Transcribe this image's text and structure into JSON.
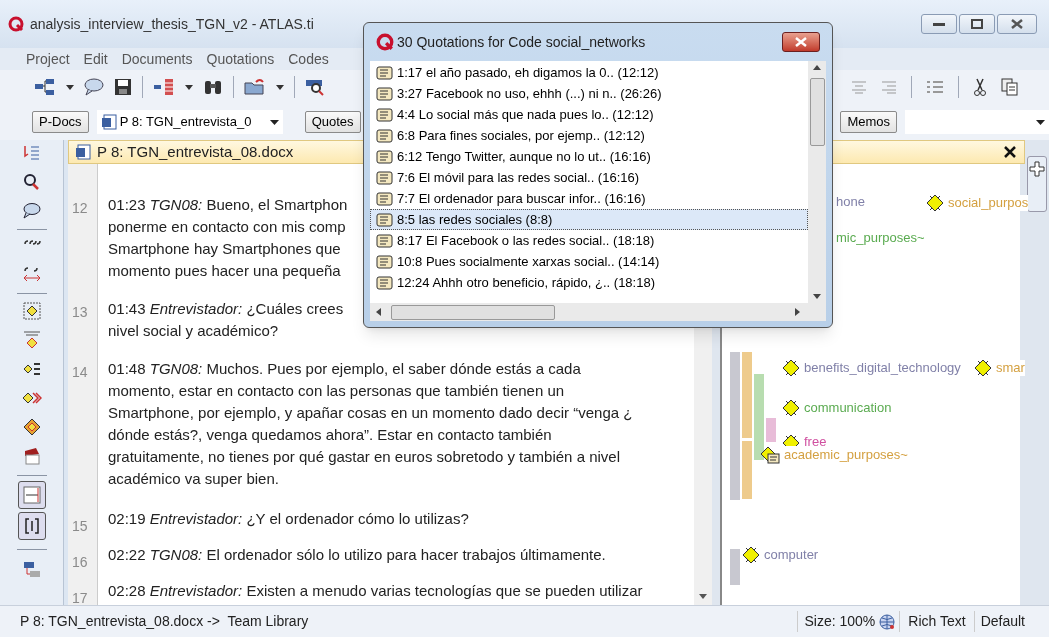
{
  "window": {
    "title": "analysis_interview_thesis_TGN_v2 - ATLAS.ti"
  },
  "menu": [
    "Project",
    "Edit",
    "Documents",
    "Quotations",
    "Codes"
  ],
  "manager_bar": {
    "pdocs_button": "P-Docs",
    "document_select": "P 8: TGN_entrevista_0",
    "quotes_button": "Quotes",
    "memos_button": "Memos"
  },
  "document_tab": {
    "title": "P 8: TGN_entrevista_08.docx"
  },
  "paragraphs": [
    {
      "number": "12",
      "lines": [
        "01:23 *TGN08:* Bueno, el Smartphon",
        "ponerme en contacto con mis comp",
        "Smartphone hay Smartphones que",
        "momento pues hacer una pequeña"
      ]
    },
    {
      "number": "13",
      "lines": [
        "01:43 *Entrevistador:* ¿Cuáles crees",
        "nivel social y académico?"
      ]
    },
    {
      "number": "14",
      "lines": [
        "01:48 *TGN08:* Muchos. Pues por ejemplo, el saber dónde estás a cada",
        "momento, estar en contacto con las personas que también tienen un",
        "Smartphone, por ejemplo, y apañar cosas en un momento dado decir “venga ¿",
        "dónde estás?, venga quedamos ahora”. Estar en contacto también",
        "gratuitamente, no tienes por qué gastar en euros sobretodo y también a nivel",
        "académico va super bien."
      ]
    },
    {
      "number": "15",
      "lines": [
        "02:19 *Entrevistador:* ¿Y el ordenador cómo lo utilizas?"
      ]
    },
    {
      "number": "16",
      "lines": [
        "02:22 *TGN08:* El ordenador sólo lo utilizo para hacer trabajos últimamente."
      ]
    },
    {
      "number": "17",
      "lines": [
        "02:28 *Entrevistador:* Existen a menudo varias tecnologías que se pueden utilizar"
      ]
    }
  ],
  "margin": {
    "bars": [
      {
        "color": "#c8c8d0"
      },
      {
        "color": "#eecb8c"
      },
      {
        "color": "#eecb8c"
      },
      {
        "color": "#b8ddb0"
      },
      {
        "color": "#e8bcd8"
      },
      {
        "color": "#c8c8d0"
      }
    ],
    "codes": [
      {
        "kind": "plain",
        "label": "hone",
        "color": "#8080a8"
      },
      {
        "kind": "code",
        "label": "social_purpos",
        "color": "#d4a040"
      },
      {
        "kind": "plain",
        "label": "mic_purposes~",
        "color": "#5aab50"
      },
      {
        "kind": "code",
        "label": "benefits_digital_technology",
        "color": "#8080a8"
      },
      {
        "kind": "code",
        "label": "smar",
        "color": "#d4a040"
      },
      {
        "kind": "code",
        "label": "communication",
        "color": "#5aab50"
      },
      {
        "kind": "code",
        "label": "free",
        "color": "#d050a0"
      },
      {
        "kind": "memo",
        "label": "academic_purposes~",
        "color": "#d4a040"
      },
      {
        "kind": "code",
        "label": "computer",
        "color": "#8080a8"
      }
    ]
  },
  "popup": {
    "title": "30 Quotations for Code social_networks",
    "items": [
      {
        "text": "1:17 el año pasado, eh digamos la 0.. (12:12)",
        "selected": false
      },
      {
        "text": "3:27 Facebook no uso, ehhh (...) ni n.. (26:26)",
        "selected": false
      },
      {
        "text": "4:4 Lo social más que nada pues lo.. (12:12)",
        "selected": false
      },
      {
        "text": "6:8 Para fines sociales, por ejemp.. (12:12)",
        "selected": false
      },
      {
        "text": "6:12 Tengo Twitter, aunque no lo ut.. (16:16)",
        "selected": false
      },
      {
        "text": "7:6 El móvil para las redes social.. (16:16)",
        "selected": false
      },
      {
        "text": "7:7 El ordenador para buscar infor.. (16:16)",
        "selected": false
      },
      {
        "text": "8:5 las redes sociales (8:8)",
        "selected": true
      },
      {
        "text": "8:17 El Facebook o las redes social.. (18:18)",
        "selected": false
      },
      {
        "text": "10:8 Pues socialmente xarxas social.. (14:14)",
        "selected": false
      },
      {
        "text": "12:24 Ahhh otro beneficio, rápido, ¿.. (18:18)",
        "selected": false
      }
    ]
  },
  "status_bar": {
    "document": "P 8: TGN_entrevista_08.docx ->  Team Library",
    "size": "Size: 100%",
    "format": "Rich Text",
    "style": "Default"
  }
}
